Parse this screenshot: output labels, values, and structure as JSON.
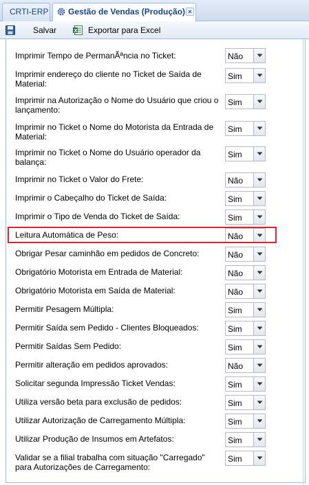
{
  "tabs": [
    {
      "label": "CRTI-ERP",
      "active": false
    },
    {
      "label": "Gestão de Vendas (Produção)",
      "active": true,
      "close": "×"
    }
  ],
  "toolbar": {
    "save_label": "Salvar",
    "export_label": "Exportar para Excel"
  },
  "settings": [
    {
      "label": "Imprimir Tempo de PermanÃªncia no Ticket:",
      "value": "Não"
    },
    {
      "label": "Imprimir endereço do cliente no Ticket de Saída de Material:",
      "value": "Sim"
    },
    {
      "label": "Imprimir na Autorização o Nome do Usuário que criou o lançamento:",
      "value": "Sim"
    },
    {
      "label": "Imprimir no Ticket o Nome do Motorista da Entrada de Material:",
      "value": "Sim"
    },
    {
      "label": "Imprimir no Ticket o Nome do Usuário operador da balança:",
      "value": "Sim"
    },
    {
      "label": "Imprimir no Ticket o Valor do Frete:",
      "value": "Não"
    },
    {
      "label": "Imprimir o Cabeçalho do Ticket de Saída:",
      "value": "Sim"
    },
    {
      "label": "Imprimir o Tipo de Venda do Ticket de Saída:",
      "value": "Sim"
    },
    {
      "label": "Leitura Automática de Peso:",
      "value": "Não"
    },
    {
      "label": "Obrigar Pesar caminhão em pedidos de Concreto:",
      "value": "Não"
    },
    {
      "label": "Obrigatório Motorista em Entrada de Material:",
      "value": "Não"
    },
    {
      "label": "Obrigatório Motorista em Saída de Material:",
      "value": "Não"
    },
    {
      "label": "Permitir Pesagem Múltipla:",
      "value": "Sim"
    },
    {
      "label": "Permitir Saída sem Pedido - Clientes Bloqueados:",
      "value": "Sim"
    },
    {
      "label": "Permitir Saídas Sem Pedido:",
      "value": "Sim"
    },
    {
      "label": "Permitir alteração em pedidos aprovados:",
      "value": "Não"
    },
    {
      "label": "Solicitar segunda Impressão Ticket Vendas:",
      "value": "Sim"
    },
    {
      "label": "Utiliza versão beta para exclusão de pedidos:",
      "value": "Sim"
    },
    {
      "label": "Utilizar Autorização de Carregamento Múltipla:",
      "value": "Sim"
    },
    {
      "label": "Utilizar Produção de Insumos em Artefatos:",
      "value": "Sim"
    },
    {
      "label": "Validar se a filial trabalha com situação \"Carregado\" para Autorizações de Carregamento:",
      "value": "Sim"
    }
  ],
  "highlight_color": "#e0222b",
  "accent_color": "#15428b"
}
